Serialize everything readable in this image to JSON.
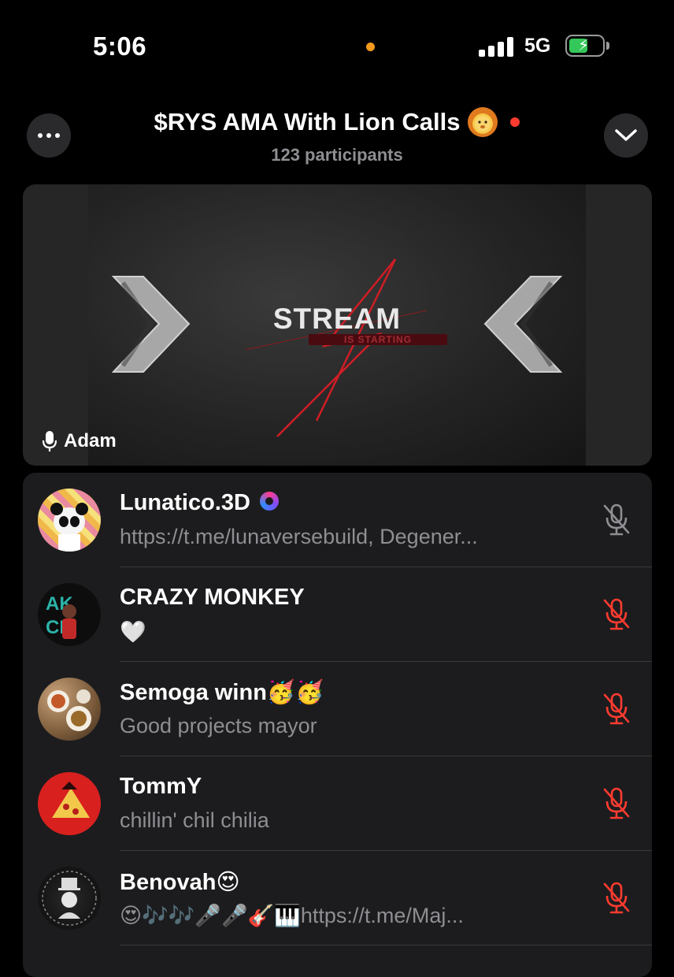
{
  "status_bar": {
    "time": "5:06",
    "network": "5G"
  },
  "header": {
    "title": "$RYS AMA With Lion Calls",
    "subtitle": "123 participants"
  },
  "video": {
    "stream_title": "STREAM",
    "stream_subtitle": "IS STARTING",
    "speaker": "Adam"
  },
  "participants": [
    {
      "name": "Lunatico.3D",
      "status": "https://t.me/lunaversebuild, Degener...",
      "muted": true,
      "mic_color": "#8e8e93"
    },
    {
      "name": "CRAZY MONKEY",
      "status": "🤍",
      "muted": true,
      "mic_color": "#ff3b30"
    },
    {
      "name": "Semoga winn🥳🥳",
      "status": "Good projects mayor",
      "muted": true,
      "mic_color": "#ff3b30"
    },
    {
      "name": "TommY",
      "status": "chillin' chil chilia",
      "muted": true,
      "mic_color": "#ff3b30"
    },
    {
      "name": "Benovah😍",
      "status": "😍🎶🎶🎤🎤🎸🎹https://t.me/Maj...",
      "muted": true,
      "mic_color": "#ff3b30"
    }
  ],
  "colors": {
    "accent_red": "#ff3b30",
    "muted_gray": "#8e8e93",
    "status_orange": "#f39a1e",
    "battery_green": "#34c759"
  }
}
